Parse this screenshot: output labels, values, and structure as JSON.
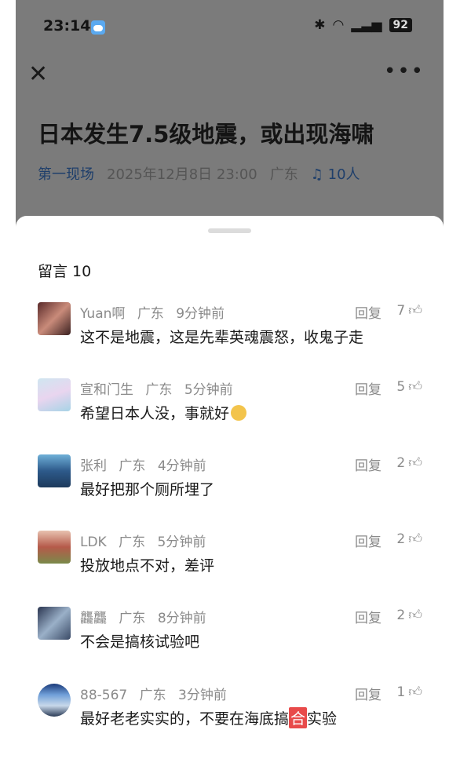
{
  "status_bar": {
    "time": "23:14",
    "battery": "92"
  },
  "article": {
    "title": "日本发生7.5级地震，或出现海啸",
    "source": "第一现场",
    "datetime": "2025年12月8日 23:00",
    "region": "广东",
    "listeners": "10人"
  },
  "comments_panel": {
    "title": "留言 10",
    "reply_label": "回复",
    "comments": [
      {
        "user": "Yuan啊",
        "region": "广东",
        "time": "9分钟前",
        "likes": "7",
        "text": "这不是地震，这是先辈英魂震怒，收鬼子走"
      },
      {
        "user": "宣和门生",
        "region": "广东",
        "time": "5分钟前",
        "likes": "5",
        "text": "希望日本人没，事就好"
      },
      {
        "user": "张利",
        "region": "广东",
        "time": "4分钟前",
        "likes": "2",
        "text": "最好把那个厕所埋了"
      },
      {
        "user": "LDK",
        "region": "广东",
        "time": "5分钟前",
        "likes": "2",
        "text": "投放地点不对，差评"
      },
      {
        "user": "龘龘",
        "region": "广东",
        "time": "8分钟前",
        "likes": "2",
        "text": "不会是搞核试验吧"
      },
      {
        "user": "88-567",
        "region": "广东",
        "time": "3分钟前",
        "likes": "1",
        "text_before": "最好老老实实的，不要在海底搞",
        "text_highlight": "合",
        "text_after": "实验"
      }
    ]
  },
  "colors": {
    "overlay": "#7b7b7b",
    "source_link": "#1f3f6b"
  }
}
